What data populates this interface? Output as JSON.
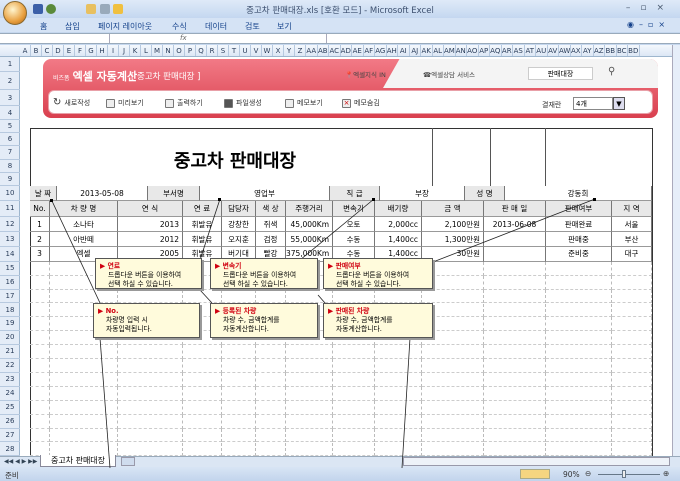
{
  "window": {
    "title": "중고차 판매대장.xls [호환 모드] - Microsoft Excel"
  },
  "ribbon": {
    "tabs": [
      "홈",
      "삽입",
      "페이지 레이아웃",
      "수식",
      "데이터",
      "검토",
      "보기"
    ]
  },
  "formula_bar": {
    "fx": "fx"
  },
  "columns": [
    "A",
    "B",
    "C",
    "D",
    "E",
    "F",
    "G",
    "H",
    "I",
    "J",
    "K",
    "L",
    "M",
    "N",
    "O",
    "P",
    "Q",
    "R",
    "S",
    "T",
    "U",
    "V",
    "W",
    "X",
    "Y",
    "Z",
    "AA",
    "AB",
    "AC",
    "AD",
    "AE",
    "AF",
    "AG",
    "AH",
    "AI",
    "AJ",
    "AK",
    "AL",
    "AM",
    "AN",
    "AO",
    "AP",
    "AQ",
    "AR",
    "AS",
    "AT",
    "AU",
    "AV",
    "AW",
    "AX",
    "AY",
    "AZ",
    "BB",
    "BC",
    "BD"
  ],
  "rows": [
    "1",
    "2",
    "3",
    "4",
    "5",
    "6",
    "7",
    "8",
    "9",
    "10",
    "11",
    "12",
    "13",
    "14",
    "15",
    "16",
    "17",
    "18",
    "19",
    "20",
    "21",
    "22",
    "23",
    "24",
    "25",
    "26",
    "27",
    "28"
  ],
  "banner": {
    "brand_small": "비즈폼",
    "brand": "엑셀 자동계산",
    "subtitle": "[ 중고차 판매대장 ]",
    "tab1": "엑셀지식 IN",
    "tab2": "엑셀상담 서비스",
    "search_value": "판매대장",
    "buttons": [
      "새로작성",
      "미리보기",
      "출력하기",
      "파일생성",
      "메모보기",
      "메모숨김"
    ],
    "approval_label": "결재란",
    "approval_value": "4개"
  },
  "doc": {
    "title": "중고차 판매대장",
    "info": {
      "date_label": "날 짜",
      "date": "2013-05-08",
      "dept_label": "부서명",
      "dept": "영업부",
      "rank_label": "직 급",
      "rank": "부장",
      "name_label": "성 명",
      "name": "강동희"
    },
    "headers": [
      "No.",
      "차 량 명",
      "연  식",
      "연 료",
      "담당자",
      "색 상",
      "주행거리",
      "변속기",
      "배기량",
      "금   액",
      "판 매 일",
      "판매여부",
      "지 역"
    ],
    "records": [
      [
        "1",
        "소나타",
        "2013",
        "휘발유",
        "강창한",
        "쥐색",
        "45,000Km",
        "오토",
        "2,000cc",
        "2,100만원",
        "2013-06-08",
        "판매완료",
        "서울"
      ],
      [
        "2",
        "아반떼",
        "2012",
        "휘발유",
        "오지훈",
        "검정",
        "55,000Km",
        "수동",
        "1,400cc",
        "1,300만원",
        "",
        "판매중",
        "부산"
      ],
      [
        "3",
        "엑셀",
        "2005",
        "휘발유",
        "버기대",
        "빨강",
        "375,000Km",
        "수동",
        "1,400cc",
        "30만원",
        "",
        "준비중",
        "대구"
      ]
    ]
  },
  "notes": [
    {
      "title": "연료",
      "l1": "드롭다운 버튼을 이용하여",
      "l2": "선택 하실 수 있습니다."
    },
    {
      "title": "변속기",
      "l1": "드롭다운 버튼을 이용하여",
      "l2": "선택 하실 수 있습니다."
    },
    {
      "title": "판매여부",
      "l1": "드롭다운 버튼을 이용하여",
      "l2": "선택 하실 수 있습니다."
    },
    {
      "title": "No.",
      "l1": "차량명 입력 시",
      "l2": "자동입력됩니다."
    },
    {
      "title": "등록된 차량",
      "l1": "차량 수, 금액합계를",
      "l2": "자동계산합니다."
    },
    {
      "title": "판매된 차량",
      "l1": "차량 수, 금액합계를",
      "l2": "자동계산합니다."
    }
  ],
  "sheet_tab": "중고차 판매대장",
  "status": {
    "ready": "준비",
    "zoom": "90%"
  }
}
